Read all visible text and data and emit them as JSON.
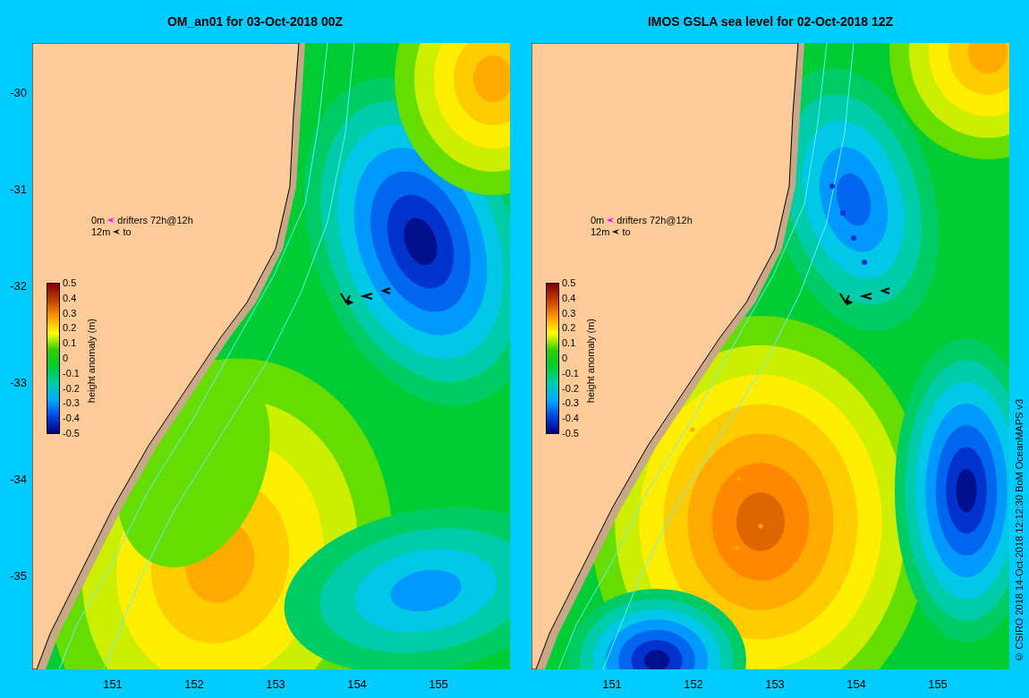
{
  "panels": [
    {
      "title": "OM_an01 for 03-Oct-2018 00Z",
      "kind": "model",
      "yticks": [
        "-30",
        "-31",
        "-32",
        "-33",
        "-34",
        "-35"
      ],
      "xticks": [
        "151",
        "152",
        "153",
        "154",
        "155"
      ],
      "legend": {
        "surface_depth": "0m",
        "surface_text": "drifters 72h@12h",
        "deep_depth": "12m",
        "deep_text": "to"
      },
      "colorbar": {
        "title": "height anomaly (m)",
        "labels": [
          "0.5",
          "0.4",
          "0.3",
          "0.2",
          "0.1",
          "0",
          "-0.1",
          "-0.2",
          "-0.3",
          "-0.4",
          "-0.5"
        ]
      }
    },
    {
      "title": "IMOS GSLA sea level  for 02-Oct-2018 12Z",
      "kind": "observed",
      "xticks": [
        "151",
        "152",
        "153",
        "154",
        "155"
      ],
      "legend": {
        "surface_depth": "0m",
        "surface_text": "drifters 72h@12h",
        "deep_depth": "12m",
        "deep_text": "to"
      },
      "colorbar": {
        "title": "height anomaly (m)",
        "labels": [
          "0.5",
          "0.4",
          "0.3",
          "0.2",
          "0.1",
          "0",
          "-0.1",
          "-0.2",
          "-0.3",
          "-0.4",
          "-0.5"
        ]
      }
    }
  ],
  "credit": "© CSIRO 2018   14-Oct-2018 12:12:30 BoM OceanMAPS v3"
}
